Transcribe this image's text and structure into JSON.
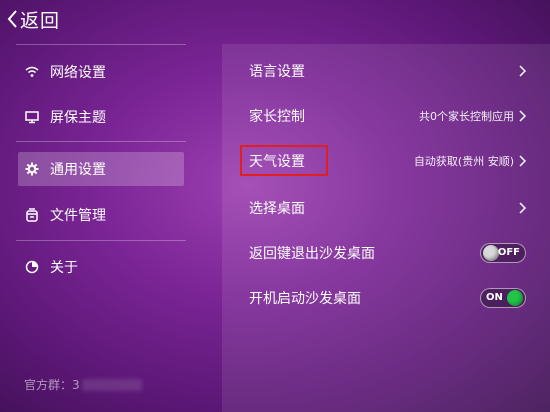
{
  "header": {
    "back_label": "返回"
  },
  "sidebar": {
    "items": [
      {
        "label": "网络设置",
        "icon": "wifi-icon"
      },
      {
        "label": "屏保主题",
        "icon": "monitor-icon"
      },
      {
        "label": "通用设置",
        "icon": "gear-icon",
        "active": true
      },
      {
        "label": "文件管理",
        "icon": "file-manager-icon"
      },
      {
        "label": "关于",
        "icon": "info-icon"
      }
    ],
    "footer_text": "官方群：3"
  },
  "settings": {
    "rows": [
      {
        "label": "语言设置",
        "value": ""
      },
      {
        "label": "家长控制",
        "value": "共0个家长控制应用"
      },
      {
        "label": "天气设置",
        "value": "自动获取(贵州 安顺)"
      },
      {
        "label": "选择桌面",
        "value": ""
      },
      {
        "label": "返回键退出沙发桌面",
        "toggle": "OFF"
      },
      {
        "label": "开机启动沙发桌面",
        "toggle": "ON"
      }
    ]
  },
  "colors": {
    "accent_on": "#22c44a",
    "highlight": "#e02020"
  }
}
